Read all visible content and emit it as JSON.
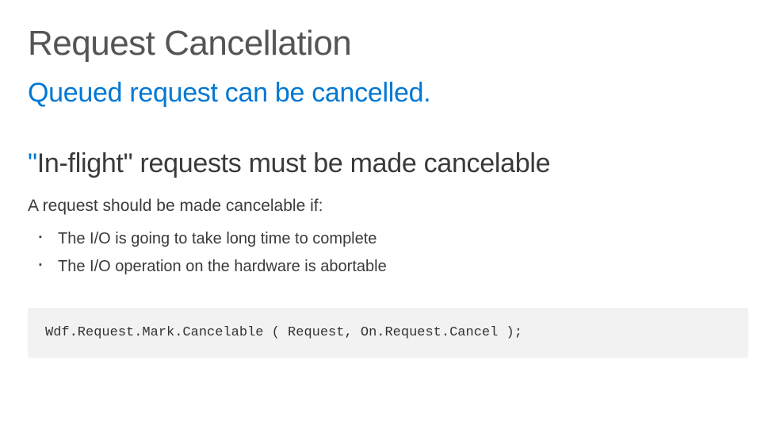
{
  "slide": {
    "title": "Request Cancellation",
    "subtitle": "Queued request can be cancelled.",
    "section_header_prefix": "\"",
    "section_header_word": "In-flight",
    "section_header_suffix": "\" requests must be made cancelable",
    "condition_intro": "A request should be made cancelable if:",
    "bullets": [
      "The I/O is going to take long time to complete",
      "The I/O operation on the hardware is abortable"
    ],
    "code": "Wdf.Request.Mark.Cancelable ( Request, On.Request.Cancel );"
  }
}
